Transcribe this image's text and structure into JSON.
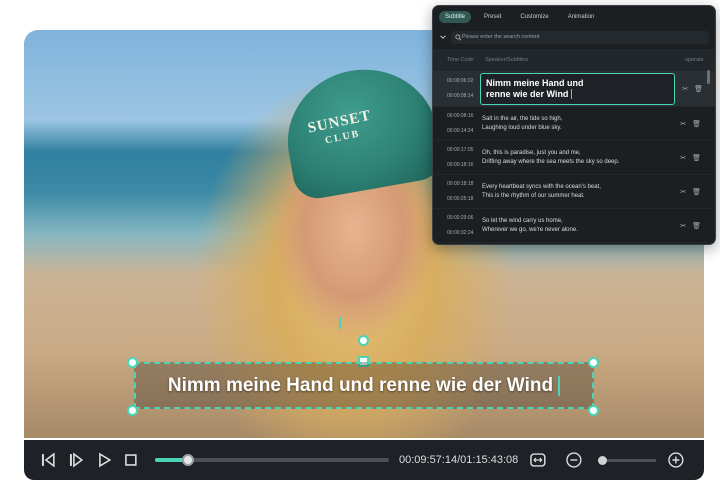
{
  "video": {
    "cap_text_line1": "SUNSET",
    "cap_text_line2": "CLUB",
    "subtitle_overlay": "Nimm meine Hand und renne wie der Wind"
  },
  "player": {
    "progress": 0.139,
    "timecode": "00:09:57:14/01:15:43:08"
  },
  "panel": {
    "tabs": [
      {
        "label": "Subtitle",
        "active": true
      },
      {
        "label": "Preset",
        "active": false
      },
      {
        "label": "Customize",
        "active": false
      },
      {
        "label": "Animation",
        "active": false
      }
    ],
    "search_placeholder": "Please enter the search content",
    "columns": {
      "time": "Time Code",
      "text": "Speaker/Subtitles",
      "ops": "operate"
    },
    "rows": [
      {
        "start": "00:00:06:02",
        "end": "00:00:08:14",
        "text1": "Nimm meine Hand und",
        "text2": "renne wie der Wind"
      },
      {
        "start": "00:00:08:16",
        "end": "00:00:14:24",
        "text1": "Salt in the air, the tide so high,",
        "text2": "Laughing loud under blue sky."
      },
      {
        "start": "00:00:17:05",
        "end": "00:00:18:16",
        "text1": "Oh, this is paradise, just you and me,",
        "text2": "Drifting away where the sea meets the sky so deep."
      },
      {
        "start": "00:00:18:18",
        "end": "00:00:25:18",
        "text1": "Every heartbeat syncs with the ocean's beat,",
        "text2": "This is the rhythm of our summer heat."
      },
      {
        "start": "00:00:29:06",
        "end": "00:00:32:24",
        "text1": "So let the wind carry us home,",
        "text2": "Wherever we go, we're never alone."
      }
    ]
  },
  "colors": {
    "accent": "#4ad6b6",
    "panel_bg": "#1b1f22",
    "player_bg": "#1e2226"
  }
}
